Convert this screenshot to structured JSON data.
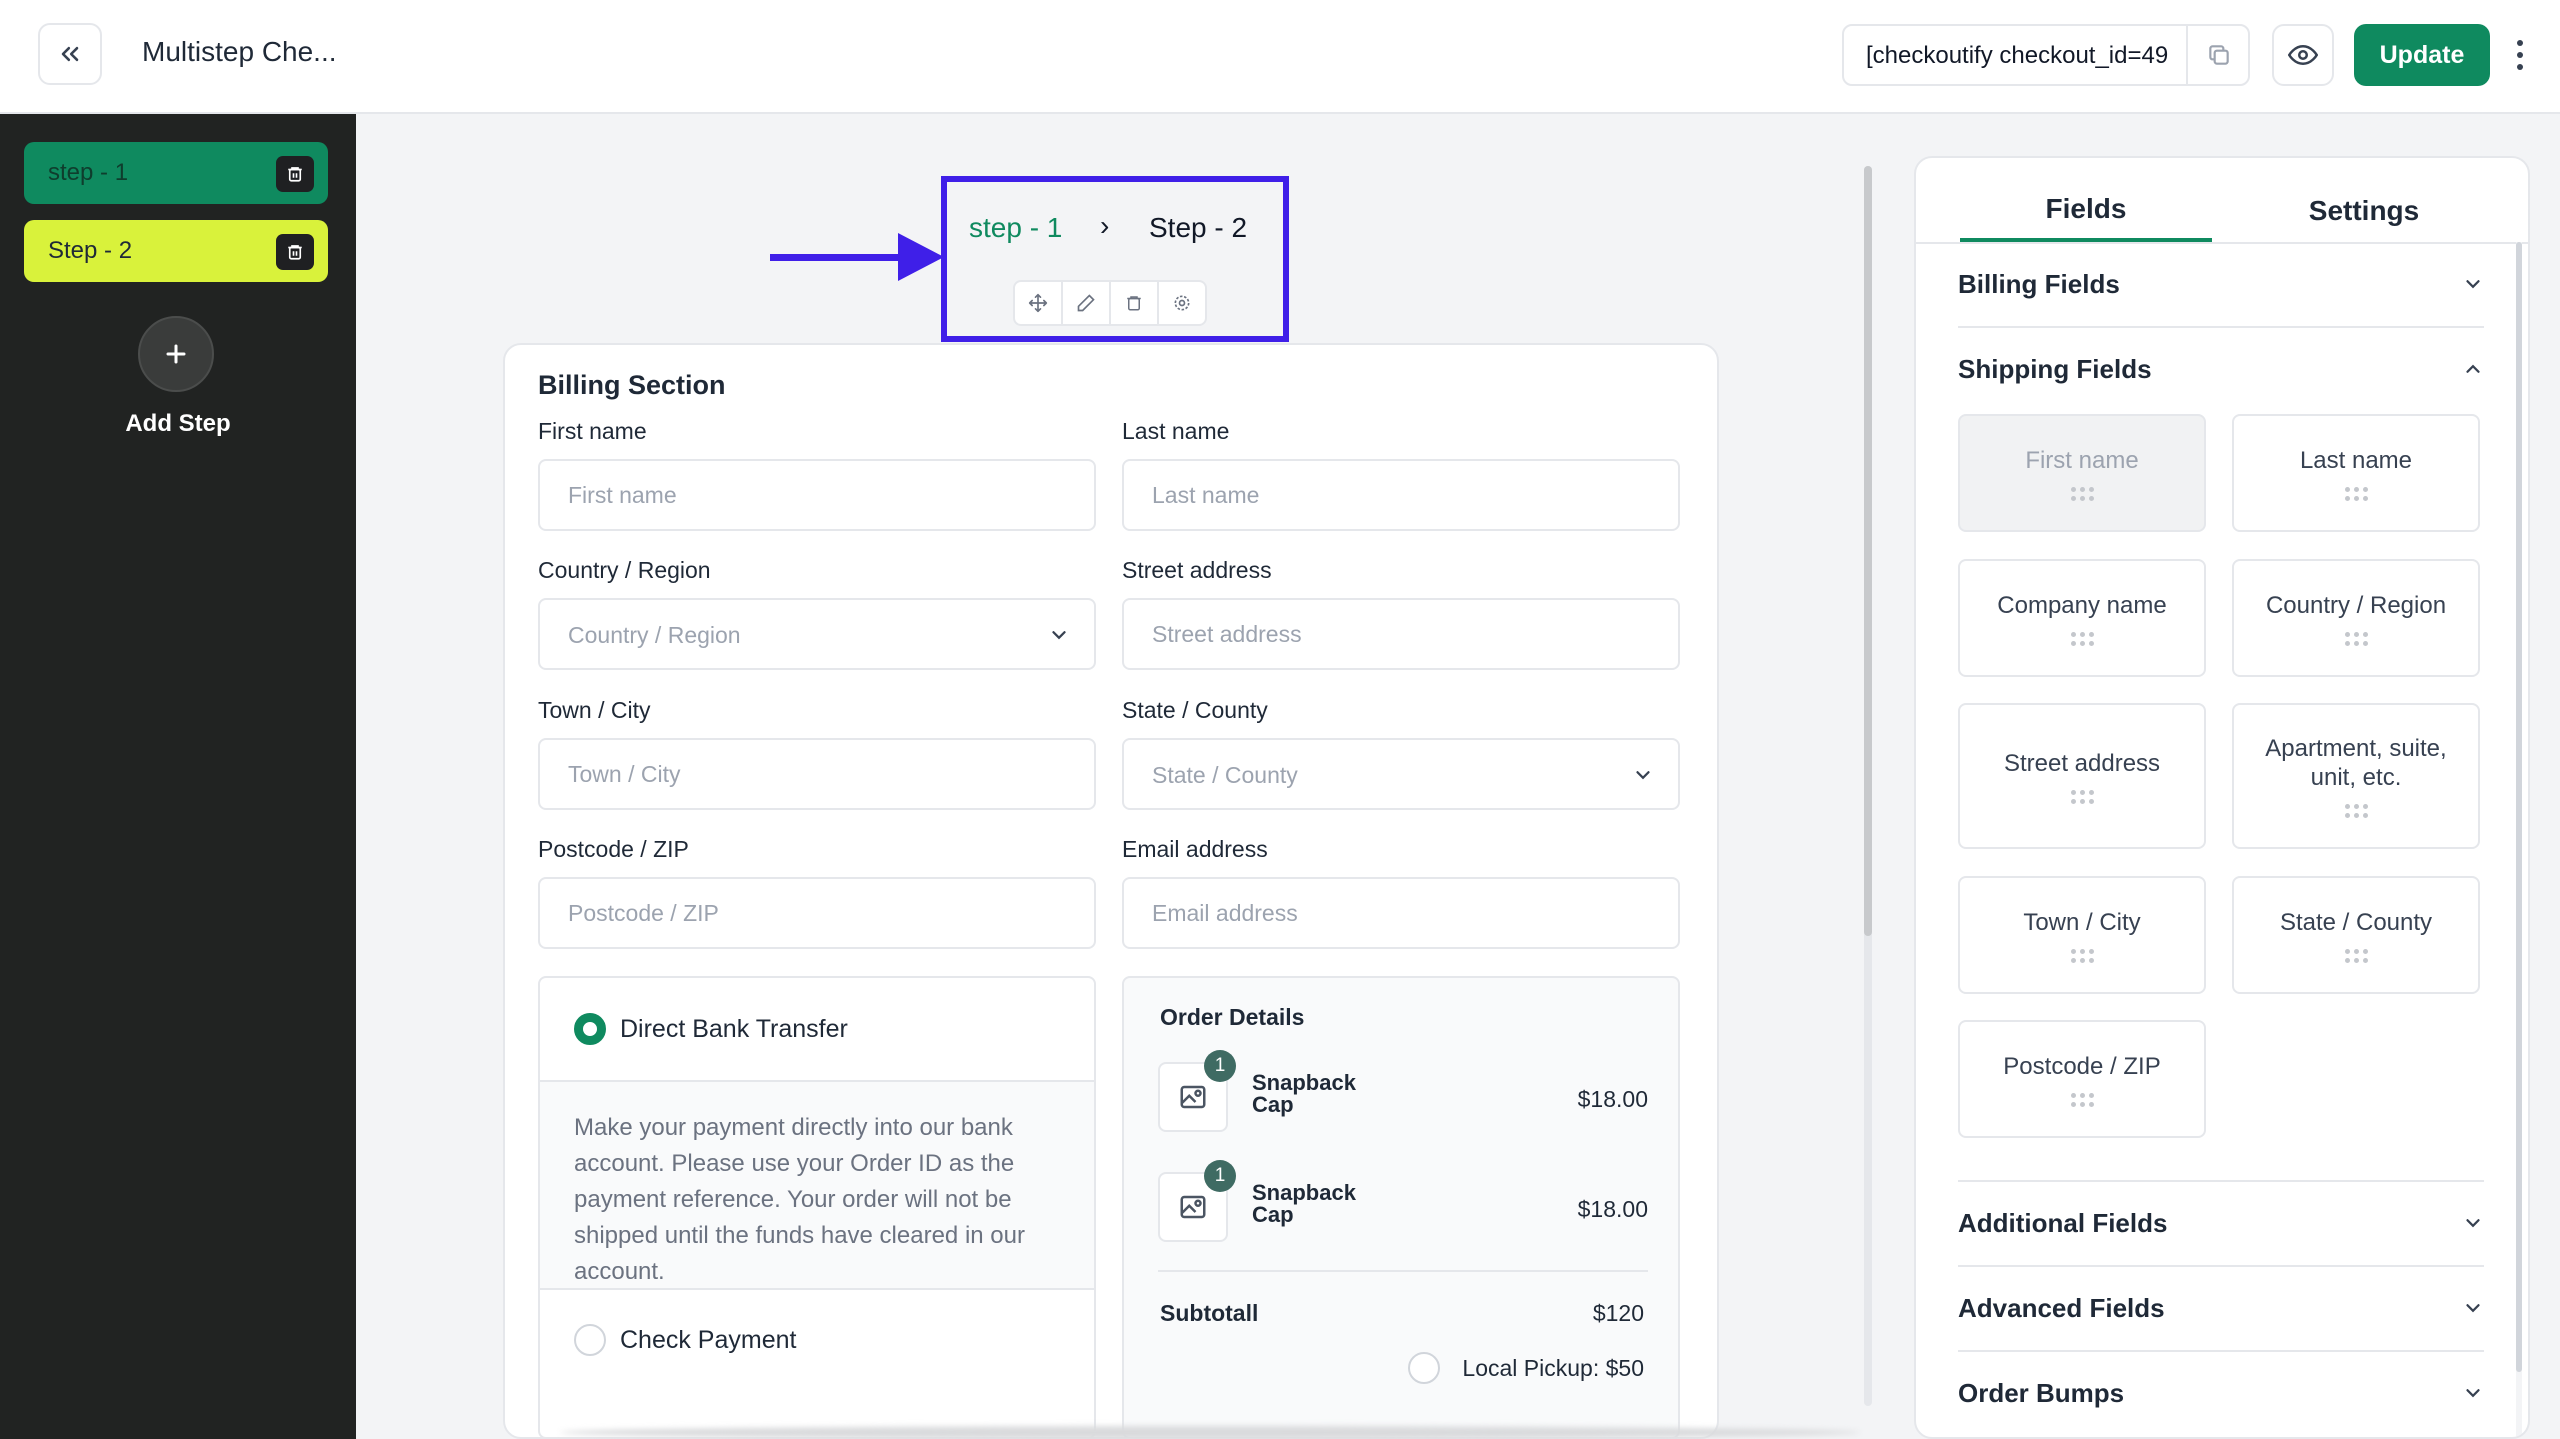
{
  "header": {
    "title": "Multistep Che...",
    "shortcode": "[checkoutify checkout_id=49",
    "update_label": "Update"
  },
  "sidebar": {
    "steps": [
      {
        "label": "step - 1"
      },
      {
        "label": "Step - 2"
      }
    ],
    "add_step_label": "Add Step"
  },
  "step_nav": {
    "step1": "step - 1",
    "separator": "›",
    "step2": "Step - 2"
  },
  "billing": {
    "section_title": "Billing Section",
    "fields": {
      "first_name": {
        "label": "First name",
        "placeholder": "First name"
      },
      "last_name": {
        "label": "Last name",
        "placeholder": "Last name"
      },
      "country": {
        "label": "Country / Region",
        "placeholder": "Country / Region"
      },
      "street": {
        "label": "Street address",
        "placeholder": "Street address"
      },
      "town": {
        "label": "Town / City",
        "placeholder": "Town / City"
      },
      "state": {
        "label": "State / County",
        "placeholder": "State / County"
      },
      "postcode": {
        "label": "Postcode / ZIP",
        "placeholder": "Postcode / ZIP"
      },
      "email": {
        "label": "Email address",
        "placeholder": "Email address"
      }
    }
  },
  "payment": {
    "bank_transfer": "Direct Bank Transfer",
    "bank_description": "Make your payment directly into our bank account. Please use your Order ID as the payment reference. Your order will not be shipped until the funds have cleared in our account.",
    "check_payment": "Check Payment"
  },
  "order": {
    "title": "Order Details",
    "items": [
      {
        "qty": "1",
        "name": "Snapback Cap",
        "price": "$18.00"
      },
      {
        "qty": "1",
        "name": "Snapback Cap",
        "price": "$18.00"
      }
    ],
    "subtotal_label": "Subtotall",
    "subtotal_value": "$120",
    "pickup_label": "Local Pickup: $50"
  },
  "right_panel": {
    "tabs": [
      "Fields",
      "Settings"
    ],
    "sections": {
      "billing": "Billing Fields",
      "shipping": "Shipping Fields",
      "additional": "Additional Fields",
      "advanced": "Advanced Fields",
      "order_bumps": "Order Bumps"
    },
    "shipping_fields": [
      "First name",
      "Last name",
      "Company name",
      "Country / Region",
      "Street address",
      "Apartment, suite, unit, etc.",
      "Town / City",
      "State / County",
      "Postcode / ZIP"
    ]
  },
  "colors": {
    "primary": "#0f8a5f",
    "step_highlight": "#d9f23b",
    "annotation": "#3f1fe8",
    "sidebar_bg": "#212322"
  }
}
